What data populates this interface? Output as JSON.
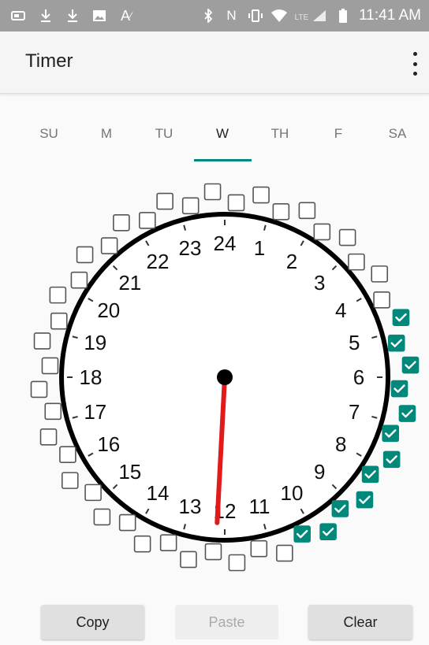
{
  "status_bar": {
    "time": "11:41 AM",
    "network": "LTE",
    "left_icons": [
      "battery-saver-icon",
      "download-icon",
      "download-icon",
      "image-icon",
      "text-icon"
    ],
    "right_icons": [
      "bluetooth-icon",
      "nfc-icon",
      "vibrate-icon",
      "wifi-icon",
      "signal-icon",
      "battery-icon"
    ]
  },
  "app_bar": {
    "title": "Timer",
    "menu_icon": "more-vert-icon"
  },
  "tabs": [
    {
      "label": "SU",
      "active": false
    },
    {
      "label": "M",
      "active": false
    },
    {
      "label": "TU",
      "active": false
    },
    {
      "label": "W",
      "active": true
    },
    {
      "label": "TH",
      "active": false
    },
    {
      "label": "F",
      "active": false
    },
    {
      "label": "SA",
      "active": false
    }
  ],
  "clock": {
    "hour_labels": [
      "1",
      "2",
      "3",
      "4",
      "5",
      "6",
      "7",
      "8",
      "9",
      "10",
      "11",
      "12",
      "13",
      "14",
      "15",
      "16",
      "17",
      "18",
      "19",
      "20",
      "21",
      "22",
      "23",
      "24"
    ],
    "slots_total": 48,
    "checked_slots": [
      9,
      10,
      11,
      12,
      13,
      14,
      15,
      16,
      17,
      18,
      19,
      20
    ],
    "hand_hour": 12.2,
    "colors": {
      "accent": "#00897b",
      "hand": "#e01b1b",
      "face": "#ffffff",
      "rim": "#000000"
    }
  },
  "buttons": {
    "copy": "Copy",
    "paste": "Paste",
    "clear": "Clear"
  }
}
